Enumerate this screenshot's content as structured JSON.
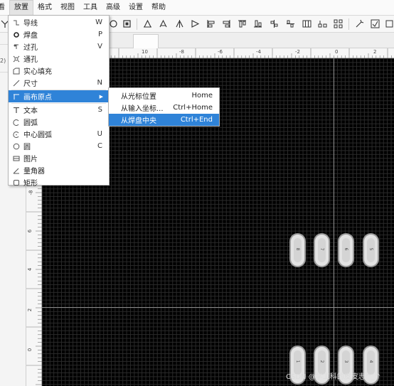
{
  "menubar": {
    "items": [
      {
        "label": "看",
        "state": "partial"
      },
      {
        "label": "放置",
        "state": "active"
      },
      {
        "label": "格式"
      },
      {
        "label": "视图"
      },
      {
        "label": "工具"
      },
      {
        "label": "高级"
      },
      {
        "label": "设置"
      },
      {
        "label": "帮助"
      }
    ]
  },
  "toolbar": {
    "icons": [
      "wire-icon",
      "wire-icon",
      "rotate-left-icon",
      "rotate-right-icon",
      "align-left-icon",
      "align-center-icon",
      "align-right-icon",
      "align-top-icon",
      "align-middle-icon",
      "align-bottom-icon",
      "distribute-h-icon",
      "distribute-v-icon",
      "grid-icon",
      "group-icon",
      "ungroup-icon",
      "magic-icon",
      "drc-icon"
    ]
  },
  "leftpanel": {
    "label": "2)"
  },
  "ruler": {
    "top_labels": [
      "10",
      "-8",
      "-6",
      "-4",
      "-2",
      "0",
      "2"
    ],
    "left_labels": [
      "-8",
      "6",
      "4",
      "2",
      "0"
    ]
  },
  "place_menu": {
    "items": [
      {
        "icon": "wire-icon",
        "label": "导线",
        "shortcut": "W"
      },
      {
        "icon": "pad-icon",
        "label": "焊盘",
        "shortcut": "P"
      },
      {
        "icon": "via-icon",
        "label": "过孔",
        "shortcut": "V"
      },
      {
        "icon": "hole-icon",
        "label": "通孔",
        "shortcut": ""
      },
      {
        "icon": "fill-icon",
        "label": "实心填充",
        "shortcut": ""
      },
      {
        "icon": "dimension-icon",
        "label": "尺寸",
        "shortcut": "N"
      },
      {
        "icon": "origin-icon",
        "label": "画布原点",
        "shortcut": "",
        "has_submenu": true,
        "highlighted": true
      },
      {
        "icon": "text-icon",
        "label": "文本",
        "shortcut": "S"
      },
      {
        "icon": "arc-icon",
        "label": "圆弧",
        "shortcut": ""
      },
      {
        "icon": "center-arc-icon",
        "label": "中心圆弧",
        "shortcut": "U"
      },
      {
        "icon": "circle-icon",
        "label": "圆",
        "shortcut": "C"
      },
      {
        "icon": "image-icon",
        "label": "图片",
        "shortcut": ""
      },
      {
        "icon": "protractor-icon",
        "label": "量角器",
        "shortcut": ""
      },
      {
        "icon": "rectangle-icon",
        "label": "矩形",
        "shortcut": ""
      }
    ]
  },
  "origin_submenu": {
    "items": [
      {
        "label": "从光标位置",
        "shortcut": "Home"
      },
      {
        "label": "从输入坐标...",
        "shortcut": "Ctrl+Home"
      },
      {
        "label": "从焊盘中央",
        "shortcut": "Ctrl+End",
        "highlighted": true
      }
    ]
  },
  "pads": {
    "top_row": [
      "8",
      "7",
      "6",
      "5"
    ],
    "bottom_row": [
      "1",
      "2",
      "3",
      "4"
    ]
  },
  "watermark": "CSDN @学工科的皮皮志^_^",
  "colors": {
    "highlight": "#2f83d8",
    "canvas_bg": "#000000",
    "grid": "#2a2a2a",
    "pad_fill": "#e3e3e3"
  }
}
